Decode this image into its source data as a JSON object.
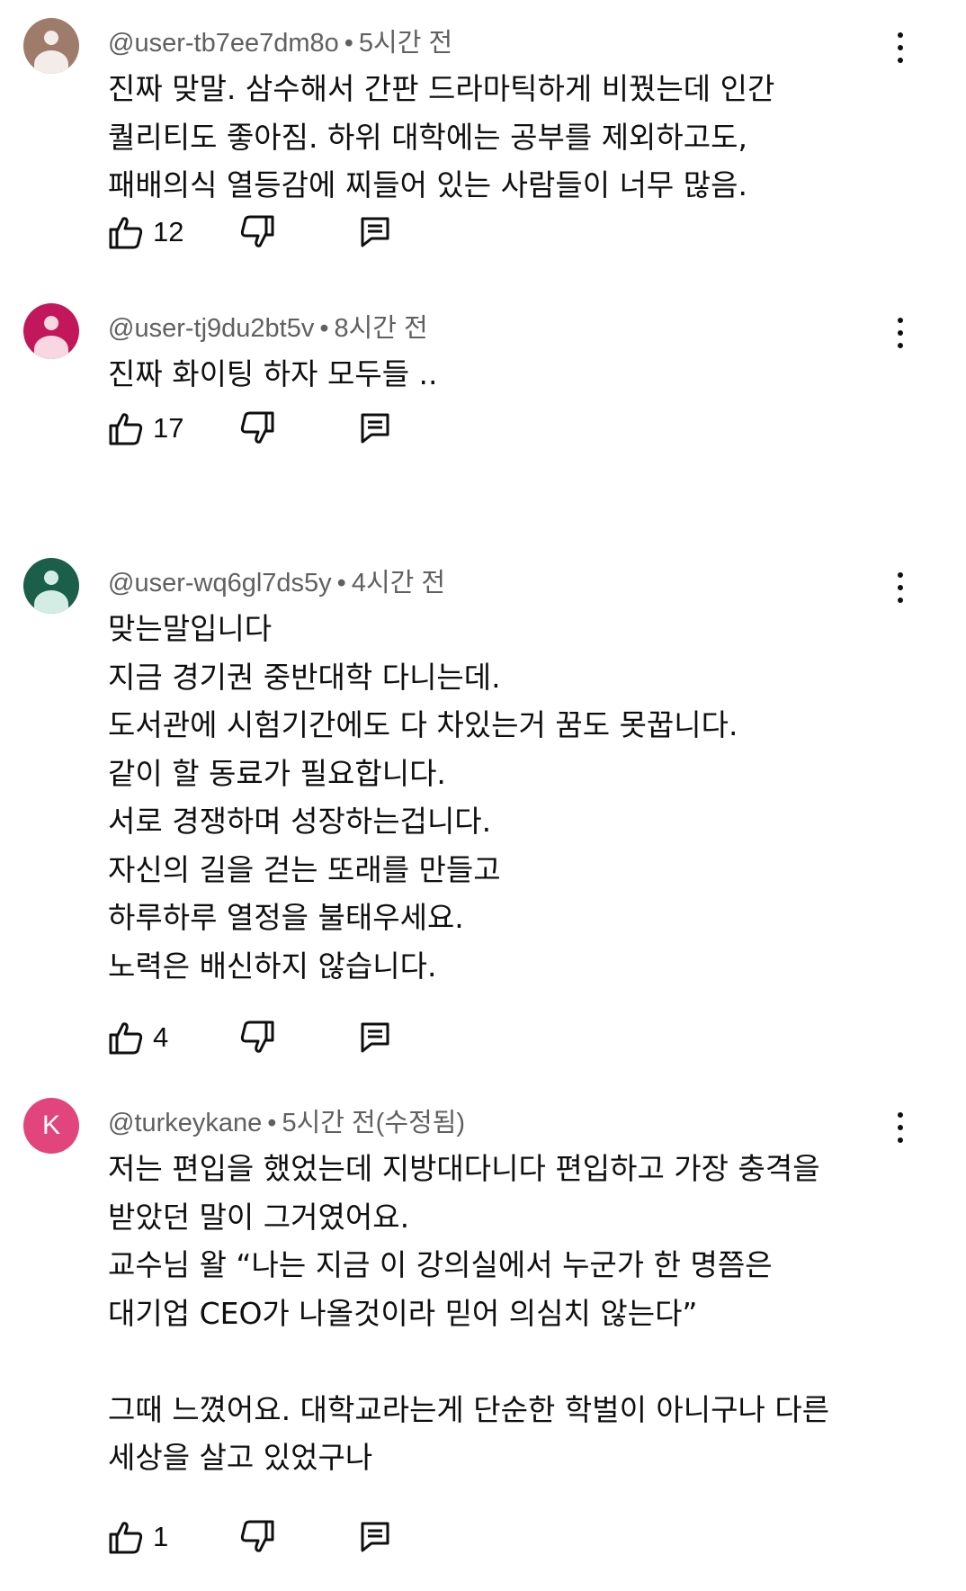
{
  "comments": [
    {
      "handle": "@user-tb7ee7dm8o",
      "time": "5시간 전",
      "avatar_color": "#9e7b6b",
      "avatar_letter": "",
      "text": "진짜 맞말. 삼수해서 간판 드라마틱하게 비꿨는데 인간\n퀄리티도 좋아짐. 하위 대학에는 공부를 제외하고도,\n패배의식 열등감에 찌들어 있는 사람들이 너무 많음.",
      "likes": "12"
    },
    {
      "handle": "@user-tj9du2bt5v",
      "time": "8시간 전",
      "avatar_color": "#c2185b",
      "avatar_letter": "",
      "text": "진짜 화이팅 하자 모두들 ..",
      "likes": "17"
    },
    {
      "handle": "@user-wq6gl7ds5y",
      "time": "4시간 전",
      "avatar_color": "#1b5e4a",
      "avatar_letter": "",
      "text": "맞는말입니다\n지금 경기권 중반대학 다니는데.\n도서관에 시험기간에도 다 차있는거 꿈도 못꿉니다.\n같이 할 동료가 필요합니다.\n서로 경쟁하며 성장하는겁니다.\n자신의 길을 걷는 또래를 만들고\n하루하루 열정을 불태우세요.\n노력은 배신하지 않습니다.",
      "likes": "4"
    },
    {
      "handle": "@turkeykane",
      "time": "5시간 전(수정됨)",
      "avatar_color": "#e2457c",
      "avatar_letter": "K",
      "text": "저는 편입을 했었는데 지방대다니다 편입하고 가장 충격을\n받았던 말이 그거였어요.\n교수님 왈 “나는 지금 이 강의실에서 누군가 한 명쯤은\n대기업 CEO가 나올것이라 믿어 의심치 않는다”\n\n그때 느꼈어요. 대학교라는게 단순한 학벌이 아니구나 다른\n세상을 살고 있었구나",
      "likes": "1"
    }
  ],
  "icons": {
    "like": "thumb-up-icon",
    "dislike": "thumb-down-icon",
    "reply": "reply-icon",
    "more": "more-vert-icon"
  }
}
